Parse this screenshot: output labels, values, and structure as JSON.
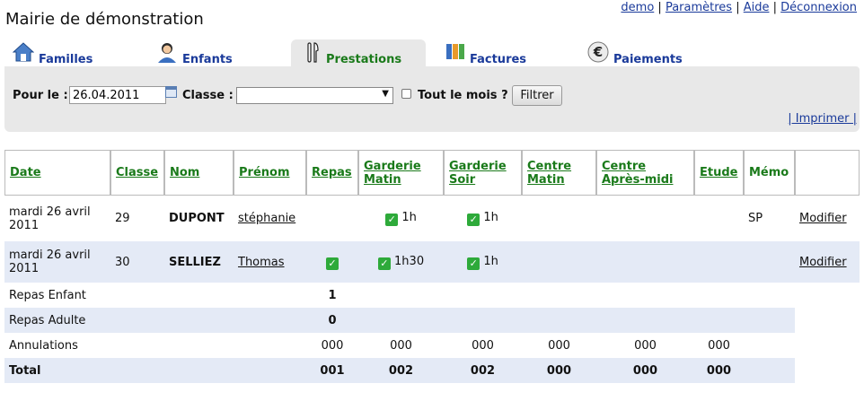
{
  "site": {
    "title": "Mairie de démonstration"
  },
  "top_links": [
    "demo",
    "Paramètres",
    "Aide",
    "Déconnexion"
  ],
  "tabs": [
    {
      "label": "Familles",
      "icon": "house-icon"
    },
    {
      "label": "Enfants",
      "icon": "child-icon"
    },
    {
      "label": "Prestations",
      "icon": "cutlery-icon",
      "active": true
    },
    {
      "label": "Factures",
      "icon": "binders-icon"
    },
    {
      "label": "Paiements",
      "icon": "euro-icon"
    }
  ],
  "filter": {
    "date_label": "Pour le :",
    "date_value": "26.04.2011",
    "class_label": "Classe :",
    "class_value": "",
    "month_label": "Tout le mois ?",
    "button": "Filtrer",
    "print": "| Imprimer |"
  },
  "table": {
    "headers": {
      "date": "Date",
      "classe": "Classe",
      "nom": "Nom",
      "prenom": "Prénom",
      "repas": "Repas",
      "gm1": "Garderie",
      "gm2": "Matin",
      "gs1": "Garderie",
      "gs2": "Soir",
      "cm1": "Centre",
      "cm2": "Matin",
      "ca1": "Centre",
      "ca2": "Après-midi",
      "etude": "Etude",
      "memo": "Mémo"
    },
    "rows": [
      {
        "date1": "mardi 26 avril",
        "date2": "2011",
        "classe": "29",
        "nom": "DUPONT",
        "prenom": "stéphanie",
        "garderie_matin": "1h",
        "garderie_soir": "1h",
        "memo": "SP",
        "action": "Modifier"
      },
      {
        "date1": "mardi 26 avril",
        "date2": "2011",
        "classe": "30",
        "nom": "SELLIEZ",
        "prenom": "Thomas",
        "garderie_matin": "1h30",
        "garderie_soir": "1h",
        "memo": "",
        "action": "Modifier"
      }
    ],
    "summary": {
      "repas_enfant": {
        "label": "Repas Enfant",
        "value": "1"
      },
      "repas_adulte": {
        "label": "Repas Adulte",
        "value": "0"
      },
      "annulations": {
        "label": "Annulations",
        "values": [
          "000",
          "000",
          "000",
          "000",
          "000",
          "000"
        ]
      },
      "total": {
        "label": "Total",
        "values": [
          "001",
          "002",
          "002",
          "000",
          "000",
          "000"
        ]
      }
    }
  },
  "colors": {
    "link_blue": "#1a3a9a",
    "header_green": "#1a7a1a",
    "row_alt": "#e4eaf6",
    "check_green": "#2eaa3a"
  }
}
